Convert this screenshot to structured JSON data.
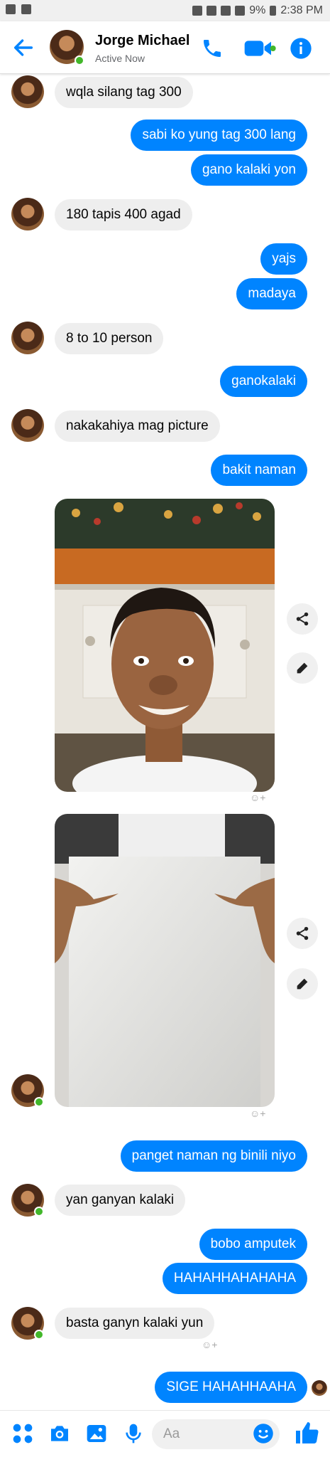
{
  "status_bar": {
    "battery": "9%",
    "time": "2:38 PM"
  },
  "header": {
    "contact_name": "Jorge Michael",
    "presence": "Active Now"
  },
  "messages": [
    {
      "dir": "in",
      "text": "wqla silang tag 300"
    },
    {
      "dir": "out",
      "text": "sabi ko yung tag 300 lang"
    },
    {
      "dir": "out",
      "text": "gano kalaki yon"
    },
    {
      "dir": "in",
      "text": "180 tapis 400 agad"
    },
    {
      "dir": "out",
      "text": "yajs"
    },
    {
      "dir": "out",
      "text": "madaya"
    },
    {
      "dir": "in",
      "text": "8 to 10 person"
    },
    {
      "dir": "out",
      "text": "ganokalaki"
    },
    {
      "dir": "in",
      "text": "nakakahiya mag picture"
    },
    {
      "dir": "out",
      "text": "bakit naman"
    },
    {
      "dir": "out",
      "text": "panget naman ng binili niyo"
    },
    {
      "dir": "in",
      "text": "yan ganyan kalaki"
    },
    {
      "dir": "out",
      "text": "bobo amputek"
    },
    {
      "dir": "out",
      "text": "HAHAHHAHAHAHA"
    },
    {
      "dir": "in",
      "text": "basta ganyn kalaki yun"
    },
    {
      "dir": "out",
      "text": "SIGE HAHAHHAAHA"
    }
  ],
  "composer": {
    "placeholder": "Aa"
  },
  "colors": {
    "accent": "#0084ff",
    "incoming_bubble": "#eeeeee",
    "online": "#42b72a"
  }
}
